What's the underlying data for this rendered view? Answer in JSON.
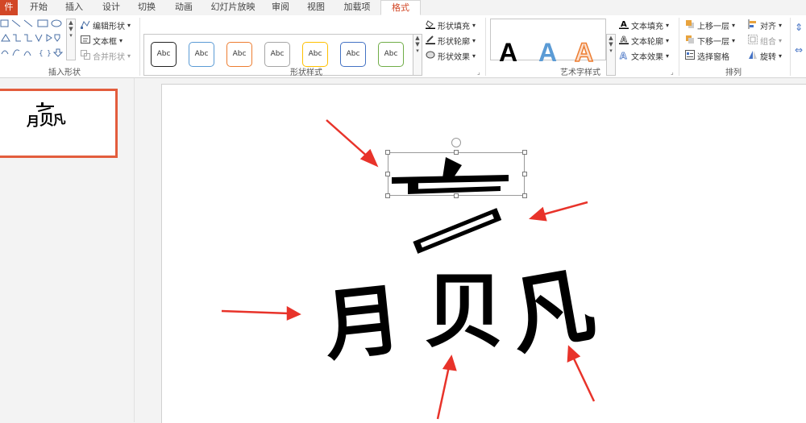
{
  "tabs": [
    "件",
    "开始",
    "插入",
    "设计",
    "切换",
    "动画",
    "幻灯片放映",
    "审阅",
    "视图",
    "加载项",
    "格式"
  ],
  "active_tab": "格式",
  "ribbon": {
    "insert_shapes": {
      "label": "插入形状",
      "edit_shape": "编辑形状",
      "text_box": "文本框",
      "merge_shapes": "合并形状"
    },
    "shape_styles": {
      "label": "形状样式",
      "style_sample": "Abc",
      "fill": "形状填充",
      "outline": "形状轮廓",
      "effects": "形状效果"
    },
    "wordart_styles": {
      "label": "艺术字样式",
      "sample": "A",
      "text_fill": "文本填充",
      "text_outline": "文本轮廓",
      "text_effects": "文本效果"
    },
    "arrange": {
      "label": "排列",
      "bring_forward": "上移一层",
      "send_backward": "下移一层",
      "selection_pane": "选择窗格",
      "align": "对齐",
      "group": "组合",
      "rotate": "旋转"
    }
  },
  "slide": {
    "glyphs": [
      "月",
      "贝",
      "凡"
    ]
  },
  "colors": {
    "accent": "#d24726",
    "arrow": "#e8332a",
    "thumb_border": "#e35d3d"
  }
}
